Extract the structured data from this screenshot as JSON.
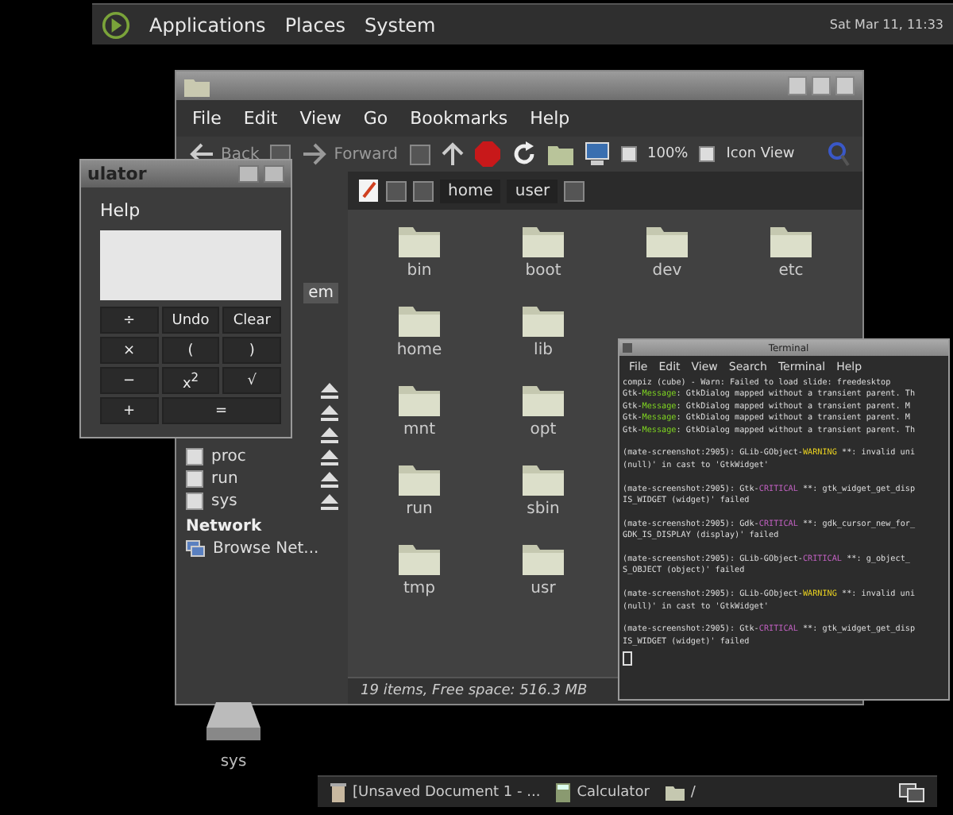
{
  "top_panel": {
    "menus": [
      "Applications",
      "Places",
      "System"
    ],
    "clock": "Sat Mar 11, 11:33"
  },
  "file_manager": {
    "menu": [
      "File",
      "Edit",
      "View",
      "Go",
      "Bookmarks",
      "Help"
    ],
    "toolbar": {
      "back": "Back",
      "forward": "Forward",
      "zoom": "100%",
      "view": "Icon View"
    },
    "path": [
      "home",
      "user"
    ],
    "sidebar": {
      "header": "em",
      "devices": [
        "proc",
        "run",
        "sys"
      ],
      "network_header": "Network",
      "network_items": [
        "Browse Net..."
      ]
    },
    "folder_rows": [
      [
        "bin",
        "boot",
        "dev",
        "etc"
      ],
      [
        "home",
        "lib"
      ],
      [
        "mnt",
        "opt"
      ],
      [
        "run",
        "sbin"
      ],
      [
        "tmp",
        "usr"
      ]
    ],
    "status": "19 items, Free space: 516.3 MB"
  },
  "calculator": {
    "title": "ulator",
    "menu": [
      "Help"
    ],
    "keys": [
      {
        "label": "÷",
        "wide": false
      },
      {
        "label": "Undo",
        "wide": false
      },
      {
        "label": "Clear",
        "wide": false
      },
      {
        "label": "×",
        "wide": false
      },
      {
        "label": "(",
        "wide": false
      },
      {
        "label": ")",
        "wide": false
      },
      {
        "label": "−",
        "wide": false
      },
      {
        "label": "x$^{2}$",
        "wide": false
      },
      {
        "label": "√",
        "wide": false
      },
      {
        "label": "+",
        "wide": false
      },
      {
        "label": "=",
        "wide": true
      }
    ]
  },
  "terminal": {
    "title": "Terminal",
    "menu": [
      "File",
      "Edit",
      "View",
      "Search",
      "Terminal",
      "Help"
    ],
    "lines": [
      {
        "gap_before": false,
        "parts": [
          {
            "text": "compiz (cube) - Warn: Failed to load slide: freedesktop",
            "kind": "plain"
          }
        ]
      },
      {
        "gap_before": false,
        "parts": [
          {
            "text": "Gtk-",
            "kind": "plain"
          },
          {
            "text": "Message",
            "kind": "message"
          },
          {
            "text": ": GtkDialog mapped without a transient parent. Th",
            "kind": "plain"
          }
        ]
      },
      {
        "gap_before": false,
        "parts": [
          {
            "text": "Gtk-",
            "kind": "plain"
          },
          {
            "text": "Message",
            "kind": "message"
          },
          {
            "text": ": GtkDialog mapped without a transient parent. M",
            "kind": "plain"
          }
        ]
      },
      {
        "gap_before": false,
        "parts": [
          {
            "text": "Gtk-",
            "kind": "plain"
          },
          {
            "text": "Message",
            "kind": "message"
          },
          {
            "text": ": GtkDialog mapped without a transient parent. M",
            "kind": "plain"
          }
        ]
      },
      {
        "gap_before": false,
        "parts": [
          {
            "text": "Gtk-",
            "kind": "plain"
          },
          {
            "text": "Message",
            "kind": "message"
          },
          {
            "text": ": GtkDialog mapped without a transient parent. Th",
            "kind": "plain"
          }
        ]
      },
      {
        "gap_before": true,
        "parts": [
          {
            "text": "(mate-screenshot:2905): GLib-GObject-",
            "kind": "plain"
          },
          {
            "text": "WARNING",
            "kind": "warning"
          },
          {
            "text": " **: invalid uni",
            "kind": "plain"
          }
        ]
      },
      {
        "gap_before": false,
        "parts": [
          {
            "text": "(null)' in cast to 'GtkWidget'",
            "kind": "plain"
          }
        ]
      },
      {
        "gap_before": true,
        "parts": [
          {
            "text": "(mate-screenshot:2905): Gtk-",
            "kind": "plain"
          },
          {
            "text": "CRITICAL",
            "kind": "critical"
          },
          {
            "text": " **: gtk_widget_get_disp",
            "kind": "plain"
          }
        ]
      },
      {
        "gap_before": false,
        "parts": [
          {
            "text": "IS_WIDGET (widget)' failed",
            "kind": "plain"
          }
        ]
      },
      {
        "gap_before": true,
        "parts": [
          {
            "text": "(mate-screenshot:2905): Gdk-",
            "kind": "plain"
          },
          {
            "text": "CRITICAL",
            "kind": "critical"
          },
          {
            "text": " **: gdk_cursor_new_for_",
            "kind": "plain"
          }
        ]
      },
      {
        "gap_before": false,
        "parts": [
          {
            "text": "GDK_IS_DISPLAY (display)' failed",
            "kind": "plain"
          }
        ]
      },
      {
        "gap_before": true,
        "parts": [
          {
            "text": "(mate-screenshot:2905): GLib-GObject-",
            "kind": "plain"
          },
          {
            "text": "CRITICAL",
            "kind": "critical"
          },
          {
            "text": " **: g_object_",
            "kind": "plain"
          }
        ]
      },
      {
        "gap_before": false,
        "parts": [
          {
            "text": "S_OBJECT (object)' failed",
            "kind": "plain"
          }
        ]
      },
      {
        "gap_before": true,
        "parts": [
          {
            "text": "(mate-screenshot:2905): GLib-GObject-",
            "kind": "plain"
          },
          {
            "text": "WARNING",
            "kind": "warning"
          },
          {
            "text": " **: invalid uni",
            "kind": "plain"
          }
        ]
      },
      {
        "gap_before": false,
        "parts": [
          {
            "text": "(null)' in cast to 'GtkWidget'",
            "kind": "plain"
          }
        ]
      },
      {
        "gap_before": true,
        "parts": [
          {
            "text": "(mate-screenshot:2905): Gtk-",
            "kind": "plain"
          },
          {
            "text": "CRITICAL",
            "kind": "critical"
          },
          {
            "text": " **: gtk_widget_get_disp",
            "kind": "plain"
          }
        ]
      },
      {
        "gap_before": false,
        "parts": [
          {
            "text": "IS_WIDGET (widget)' failed",
            "kind": "plain"
          }
        ]
      }
    ]
  },
  "desktop_icons": [
    "sys"
  ],
  "bottom_panel": {
    "tasks": [
      {
        "label": "[Unsaved Document 1 - ..."
      },
      {
        "label": "Calculator"
      },
      {
        "label": "/"
      }
    ]
  }
}
